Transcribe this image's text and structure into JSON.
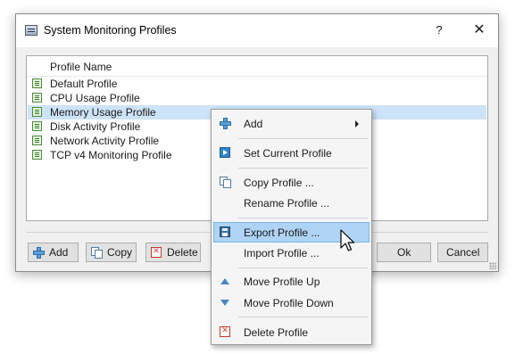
{
  "dialog": {
    "title": "System Monitoring Profiles",
    "help_label": "?",
    "close_label": "✕"
  },
  "list": {
    "column_header": "Profile Name",
    "selected_index": 2,
    "items": [
      {
        "label": "Default Profile"
      },
      {
        "label": "CPU Usage Profile"
      },
      {
        "label": "Memory Usage Profile"
      },
      {
        "label": "Disk Activity Profile"
      },
      {
        "label": "Network Activity Profile"
      },
      {
        "label": "TCP v4 Monitoring Profile"
      }
    ]
  },
  "buttons": {
    "add": "Add",
    "copy": "Copy",
    "delete": "Delete",
    "ok": "Ok",
    "cancel": "Cancel"
  },
  "context_menu": {
    "hovered_item": "Export Profile ...",
    "items": [
      {
        "label": "Add",
        "icon": "plus-icon",
        "submenu": true
      },
      {
        "label": "Set Current Profile",
        "icon": "play-icon"
      },
      {
        "label": "Copy Profile ...",
        "icon": "copy-icon"
      },
      {
        "label": "Rename Profile ..."
      },
      {
        "label": "Export Profile ...",
        "icon": "save-icon"
      },
      {
        "label": "Import Profile ..."
      },
      {
        "label": "Move Profile Up",
        "icon": "arrow-up-icon"
      },
      {
        "label": "Move Profile Down",
        "icon": "arrow-down-icon"
      },
      {
        "label": "Delete Profile",
        "icon": "delete-icon"
      }
    ]
  },
  "colors": {
    "selection": "#cde3f7",
    "menu_hover": "#aed3f4",
    "accent": "#2f84c8"
  }
}
